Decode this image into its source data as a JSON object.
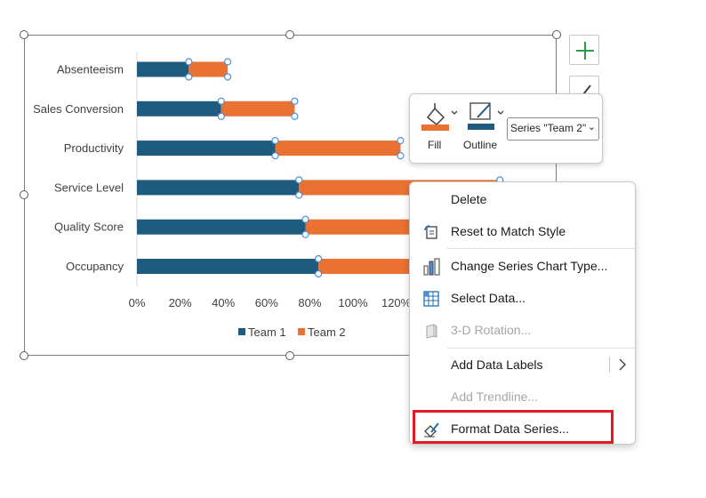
{
  "chart_data": {
    "type": "bar",
    "orientation": "horizontal",
    "stacked": true,
    "categories": [
      "Absenteeism",
      "Sales Conversion",
      "Productivity",
      "Service Level",
      "Quality Score",
      "Occupancy"
    ],
    "series": [
      {
        "name": "Team 1",
        "values": [
          24,
          39,
          64,
          75,
          78,
          84
        ],
        "color": "#1f5b7e"
      },
      {
        "name": "Team 2",
        "values": [
          18,
          34,
          58,
          93,
          96,
          96
        ],
        "color": "#e97131"
      }
    ],
    "xticks": [
      "0%",
      "20%",
      "40%",
      "60%",
      "80%",
      "100%",
      "120%"
    ],
    "xlim": [
      0,
      200
    ],
    "legend_position": "bottom",
    "selected_series": "Team 2"
  },
  "toolbar": {
    "fill_label": "Fill",
    "outline_label": "Outline",
    "series_select_value": "Series \"Team 2\"",
    "fill_color": "#e97131",
    "outline_color": "#1f5b7e"
  },
  "menu": {
    "items": [
      {
        "label": "Delete",
        "icon": "none",
        "enabled": true
      },
      {
        "label": "Reset to Match Style",
        "icon": "reset-style-icon",
        "enabled": true
      },
      {
        "label": "Change Series Chart Type...",
        "icon": "chart-type-icon",
        "enabled": true
      },
      {
        "label": "Select Data...",
        "icon": "select-data-icon",
        "enabled": true
      },
      {
        "label": "3-D Rotation...",
        "icon": "rotation-icon",
        "enabled": false
      },
      {
        "label": "Add Data Labels",
        "icon": "none",
        "enabled": true,
        "submenu": true
      },
      {
        "label": "Add Trendline...",
        "icon": "none",
        "enabled": false
      },
      {
        "label": "Format Data Series...",
        "icon": "format-series-icon",
        "enabled": true,
        "highlighted": true
      }
    ]
  },
  "colors": {
    "highlight": "#e01b24",
    "add_button": "#2e9b48"
  }
}
